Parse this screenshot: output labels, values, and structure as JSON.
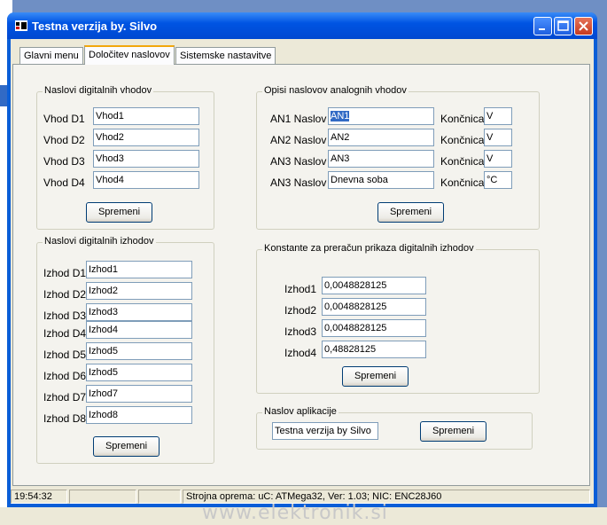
{
  "window": {
    "title": "Testna verzija by. Silvo"
  },
  "tabs": [
    {
      "label": "Glavni menu"
    },
    {
      "label": "Določitev naslovov"
    },
    {
      "label": "Sistemske nastavitve"
    }
  ],
  "digital_inputs": {
    "title": "Naslovi digitalnih vhodov",
    "rows": [
      {
        "label": "Vhod D1",
        "value": "Vhod1"
      },
      {
        "label": "Vhod D2",
        "value": "Vhod2"
      },
      {
        "label": "Vhod D3",
        "value": "Vhod3"
      },
      {
        "label": "Vhod D4",
        "value": "Vhod4"
      }
    ],
    "button": "Spremeni"
  },
  "digital_outputs": {
    "title": "Naslovi digitalnih izhodov",
    "rows": [
      {
        "label": "Izhod D1",
        "value": "Izhod1"
      },
      {
        "label": "Izhod D2",
        "value": "Izhod2"
      },
      {
        "label": "Izhod D3",
        "value": "Izhod3"
      },
      {
        "label": "Izhod D4",
        "value": "Izhod4"
      },
      {
        "label": "Izhod D5",
        "value": "Izhod5"
      },
      {
        "label": "Izhod D6",
        "value": "Izhod5"
      },
      {
        "label": "Izhod D7",
        "value": "Izhod7"
      },
      {
        "label": "Izhod D8",
        "value": "Izhod8"
      }
    ],
    "button": "Spremeni"
  },
  "analog_inputs": {
    "title": "Opisi naslovov analognih vhodov",
    "rows": [
      {
        "label": "AN1 Naslov",
        "value": "AN1",
        "unit_label": "Končnica",
        "unit": "V"
      },
      {
        "label": "AN2 Naslov",
        "value": "AN2",
        "unit_label": "Končnica",
        "unit": "V"
      },
      {
        "label": "AN3 Naslov",
        "value": "AN3",
        "unit_label": "Končnica",
        "unit": "V"
      },
      {
        "label": "AN3 Naslov",
        "value": "Dnevna soba",
        "unit_label": "Končnica",
        "unit": "°C"
      }
    ],
    "button": "Spremeni"
  },
  "constants": {
    "title": "Konstante za preračun prikaza digitalnih izhodov",
    "rows": [
      {
        "label": "Izhod1",
        "value": "0,0048828125"
      },
      {
        "label": "Izhod2",
        "value": "0,0048828125"
      },
      {
        "label": "Izhod3",
        "value": "0,0048828125"
      },
      {
        "label": "Izhod4",
        "value": "0,48828125"
      }
    ],
    "button": "Spremeni"
  },
  "app_title": {
    "title": "Naslov aplikacije",
    "value": "Testna verzija by Silvo",
    "button": "Spremeni"
  },
  "statusbar": {
    "time": "19:54:32",
    "info": "Strojna oprema: uC: ATMega32, Ver: 1.03; NIC: ENC28J60"
  },
  "watermark": "www.elektronik.si"
}
